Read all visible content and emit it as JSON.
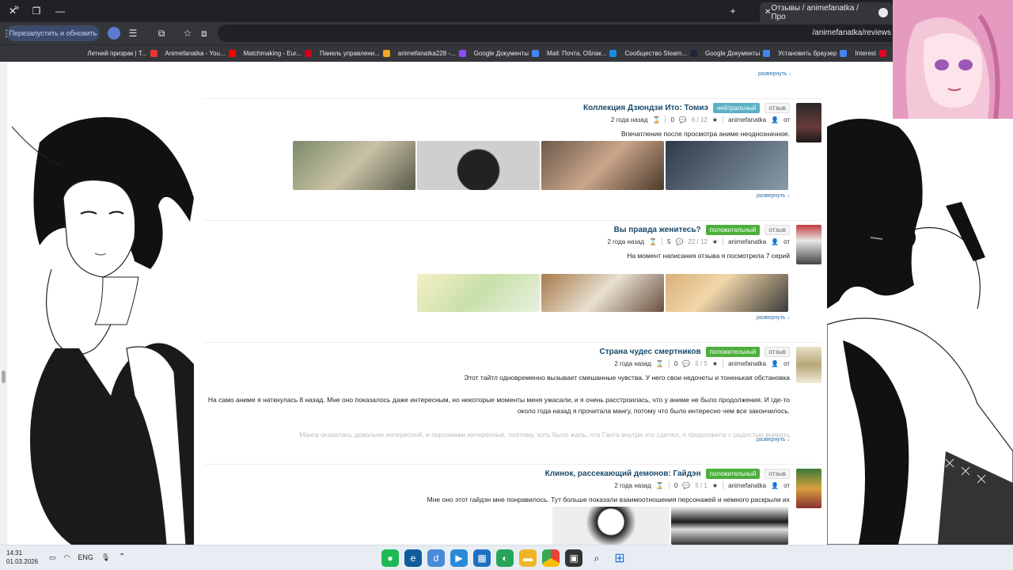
{
  "browser": {
    "tab_title": "Отзывы / animefanatka / Про",
    "address": "/animefanatka/reviews",
    "restart_label": "Перезапустить и обновить",
    "bookmarks_more": "»",
    "bookmarks": [
      {
        "label": "Interest",
        "color": "#e60023"
      },
      {
        "label": "Установить браузер",
        "color": "#4285f4"
      },
      {
        "label": "Google Документы",
        "color": "#4285f4"
      },
      {
        "label": "Сообщество Steam...",
        "color": "#1b2838"
      },
      {
        "label": "Mail: Почта, Облак...",
        "color": "#168de2"
      },
      {
        "label": "Google Документы",
        "color": "#4285f4"
      },
      {
        "label": "animefanatka228 -...",
        "color": "#9146ff"
      },
      {
        "label": "Панель управлени...",
        "color": "#f5a623"
      },
      {
        "label": "Matchmaking - Eur...",
        "color": "#d0021b"
      },
      {
        "label": "Animefanatka - You...",
        "color": "#ff0000"
      },
      {
        "label": "Летний призрак | T...",
        "color": "#e33"
      }
    ]
  },
  "page": {
    "top_expand": "развернуть ↓",
    "reviews": [
      {
        "type_label": "отзыв",
        "rating_label": "нейтральный",
        "rating_color": "#5bb0c4",
        "title": "Коллекция Дзюндзи Ито: Томиэ",
        "author_prefix": "от",
        "author": "animefanatka",
        "score": "6 / 12",
        "comments": "0",
        "date": "2 года назад",
        "text": "Впечатление после просмотра аниме неоднозначное.",
        "expand": "развернуть ↓"
      },
      {
        "type_label": "отзыв",
        "rating_label": "положительный",
        "rating_color": "#4caf3c",
        "title": "Вы правда женитесь?",
        "author_prefix": "от",
        "author": "animefanatka",
        "score": "22 / 12",
        "comments": "5",
        "date": "2 года назад",
        "text": "На момент написания отзыва я посмотрела 7 серий",
        "expand": "развернуть ↓"
      },
      {
        "type_label": "отзыв",
        "rating_label": "положительный",
        "rating_color": "#4caf3c",
        "title": "Страна чудес смертников",
        "author_prefix": "от",
        "author": "animefanatka",
        "score": "5 / 5",
        "comments": "0",
        "date": "2 года назад",
        "text": "Этот тайтл одновременно вызывает смешанные чувства. У него свои недочеты и тоненькая обстановка",
        "text2": "На само аниме я наткнулась 8 назад. Мне оно показалось даже интересным, но некоторые моменты меня ужасали, и я очень расстроилась, что у аниме не было продолжения. И где-то около года назад я прочитала мангу, потому что было интересно чем все закончилось.",
        "text3": "Манга оказалась довольно интересной, и персонажи интересные, поэтому, хоть было жаль, что Ганта внутри это сделал, я продолжила с радостью вникать",
        "expand": "развернуть ↓"
      },
      {
        "type_label": "отзыв",
        "rating_label": "положительный",
        "rating_color": "#4caf3c",
        "title": "Клинок, рассекающий демонов: Гайдэн",
        "author_prefix": "от",
        "author": "animefanatka",
        "score": "5 / 1",
        "comments": "0",
        "date": "2 года назад",
        "text": "Мне оно этот гайдэн мне понравилось. Тут больше показали взаимоотношения персонажей и немного раскрыли их"
      }
    ]
  },
  "taskbar": {
    "time": "14:31",
    "date": "01.03.2026",
    "lang": "ENG"
  }
}
